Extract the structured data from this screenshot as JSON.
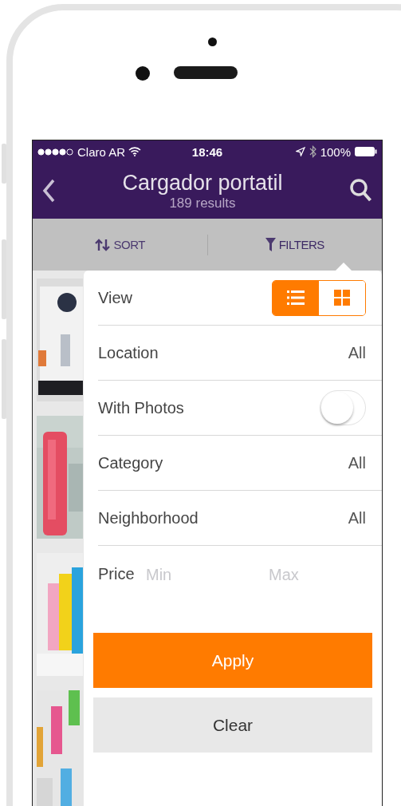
{
  "status_bar": {
    "carrier": "Claro AR",
    "time": "18:46",
    "battery": "100%"
  },
  "nav": {
    "title": "Cargador portatil",
    "subtitle": "189 results"
  },
  "toolbar": [
    {
      "kind": "sort",
      "label": "SORT",
      "selected": false
    },
    {
      "kind": "filters",
      "label": "FILTERS",
      "selected": true
    }
  ],
  "filters": [
    {
      "kind": "view",
      "label": "View",
      "options": [
        {
          "kind": "list",
          "selected": true
        },
        {
          "kind": "grid",
          "selected": false
        }
      ]
    },
    {
      "kind": "value",
      "label": "Location",
      "value": "All"
    },
    {
      "kind": "toggle",
      "label": "With Photos",
      "on": false
    },
    {
      "kind": "value",
      "label": "Category",
      "value": "All"
    },
    {
      "kind": "value",
      "label": "Neighborhood",
      "value": "All"
    },
    {
      "kind": "range",
      "label": "Price",
      "min_placeholder": "Min",
      "max_placeholder": "Max"
    }
  ],
  "buttons": [
    {
      "kind": "primary",
      "label": "Apply"
    },
    {
      "kind": "secondary",
      "label": "Clear"
    }
  ]
}
